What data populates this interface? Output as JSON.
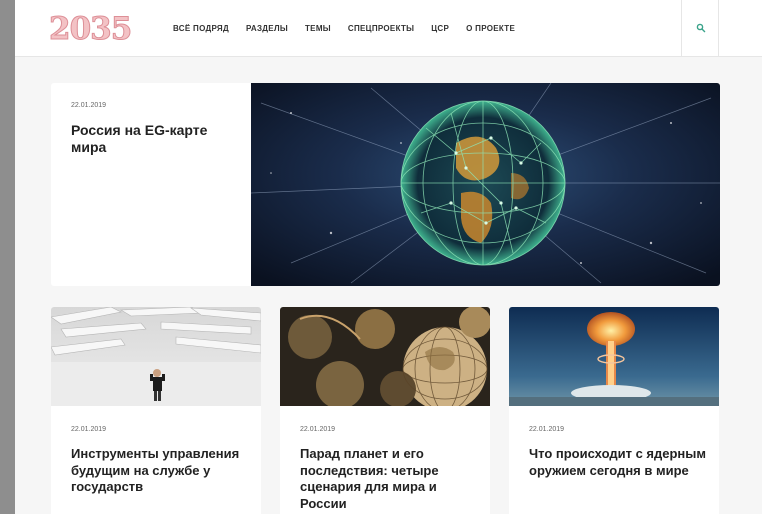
{
  "site": {
    "logo": "2035"
  },
  "nav": {
    "items": [
      {
        "label": "ВСЁ ПОДРЯД"
      },
      {
        "label": "РАЗДЕЛЫ"
      },
      {
        "label": "ТЕМЫ"
      },
      {
        "label": "СПЕЦПРОЕКТЫ"
      },
      {
        "label": "ЦСР"
      },
      {
        "label": "О ПРОЕКТЕ"
      }
    ]
  },
  "search": {
    "icon": "search-icon"
  },
  "hero": {
    "date": "22.01.2019",
    "title": "Россия на EG-карте мира",
    "image": "globe-network-image"
  },
  "cards": [
    {
      "date": "22.01.2019",
      "title": "Инструменты управления будущим на службе у государств",
      "image": "maze-person-image"
    },
    {
      "date": "22.01.2019",
      "title": "Парад планет и его последствия: четыре сценария для мира и России",
      "image": "antique-globes-image"
    },
    {
      "date": "22.01.2019",
      "title": "Что происходит с ядерным оружием сегодня в мире",
      "image": "nuclear-explosion-image"
    }
  ],
  "colors": {
    "logo": "#f3c2c5",
    "accent": "#3aa38a",
    "background": "#f6f6f6"
  }
}
